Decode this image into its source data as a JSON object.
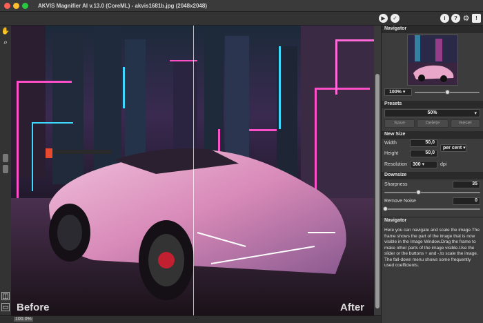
{
  "window": {
    "title": "AKVIS Magnifier AI v.13.0 (CoreML) - akvis1681b.jpg (2048x2048)"
  },
  "toolbar": {
    "run_icon": "play-icon",
    "apply_icon": "checkmark-icon",
    "info_icon": "info-icon",
    "help_icon": "help-icon",
    "settings_icon": "gear-icon",
    "notice_icon": "notice-icon"
  },
  "canvas": {
    "before_label": "Before",
    "after_label": "After",
    "zoom_status": "100.0%"
  },
  "navigator": {
    "header": "Navigator",
    "zoom_value": "100%",
    "zoom_slider_fraction": 0.5
  },
  "presets": {
    "header": "Presets",
    "selected": "50%",
    "save_label": "Save",
    "delete_label": "Delete",
    "reset_label": "Reset"
  },
  "new_size": {
    "header": "New Size",
    "width_label": "Width",
    "width_value": "50,0",
    "height_label": "Height",
    "height_value": "50,0",
    "unit": "per cent",
    "resolution_label": "Resolution",
    "resolution_value": "300",
    "resolution_unit": "dpi"
  },
  "downsize": {
    "header": "Downsize",
    "sharpness_label": "Sharpness",
    "sharpness_value": "35",
    "remove_noise_label": "Remove Noise",
    "remove_noise_value": "0"
  },
  "help": {
    "header": "Navigator",
    "text": "Here you can navigate and scale the image.The frame shows the part of the image that is now visible in the Image Window.Drag the frame to make other parts of the image visible.Use the slider or the buttons + and -,to scale the image. The fall-down menu shows some frequently used coefficients."
  },
  "colors": {
    "panel_bg": "#3c3c3c",
    "header_bg": "#2a2a2a",
    "car_pink": "#e8a6c8",
    "neon_magenta": "#ff4fc8",
    "neon_cyan": "#3fd8ff"
  }
}
